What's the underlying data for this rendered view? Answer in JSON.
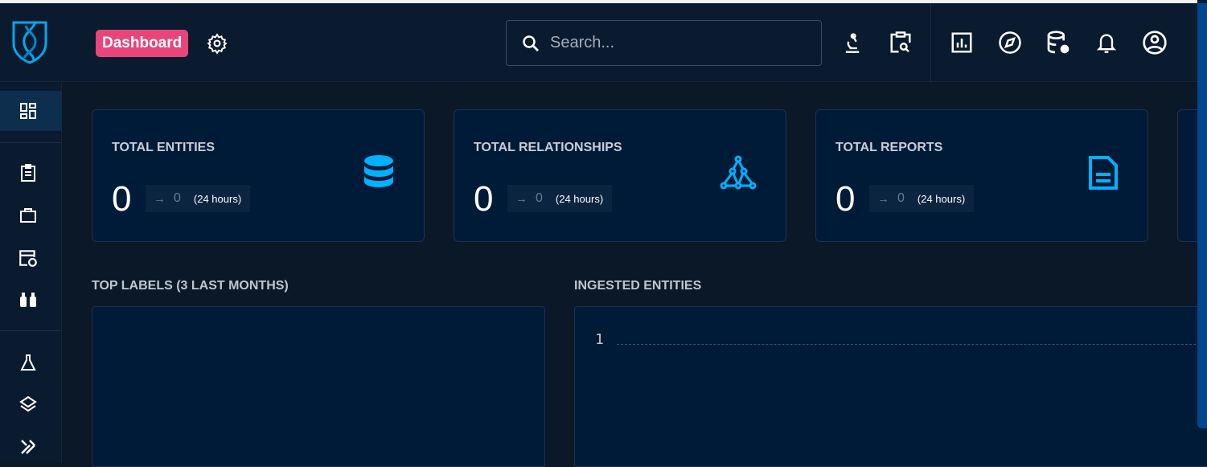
{
  "header": {
    "badge": "Dashboard",
    "search_placeholder": "Search..."
  },
  "cards": [
    {
      "title": "TOTAL ENTITIES",
      "value": "0",
      "delta": "0",
      "period": "(24 hours)",
      "icon": "database-icon"
    },
    {
      "title": "TOTAL RELATIONSHIPS",
      "value": "0",
      "delta": "0",
      "period": "(24 hours)",
      "icon": "graph-icon"
    },
    {
      "title": "TOTAL REPORTS",
      "value": "0",
      "delta": "0",
      "period": "(24 hours)",
      "icon": "file-document-icon"
    }
  ],
  "sections": {
    "top_labels": "TOP LABELS (3 LAST MONTHS)",
    "ingested": "INGESTED ENTITIES"
  },
  "chart_data": {
    "type": "line",
    "title": "INGESTED ENTITIES",
    "y_ticks": [
      "1"
    ],
    "series": []
  },
  "colors": {
    "accent": "#00b1ff",
    "badge": "#e8457a",
    "background": "#0b1827",
    "card": "#001b38"
  }
}
